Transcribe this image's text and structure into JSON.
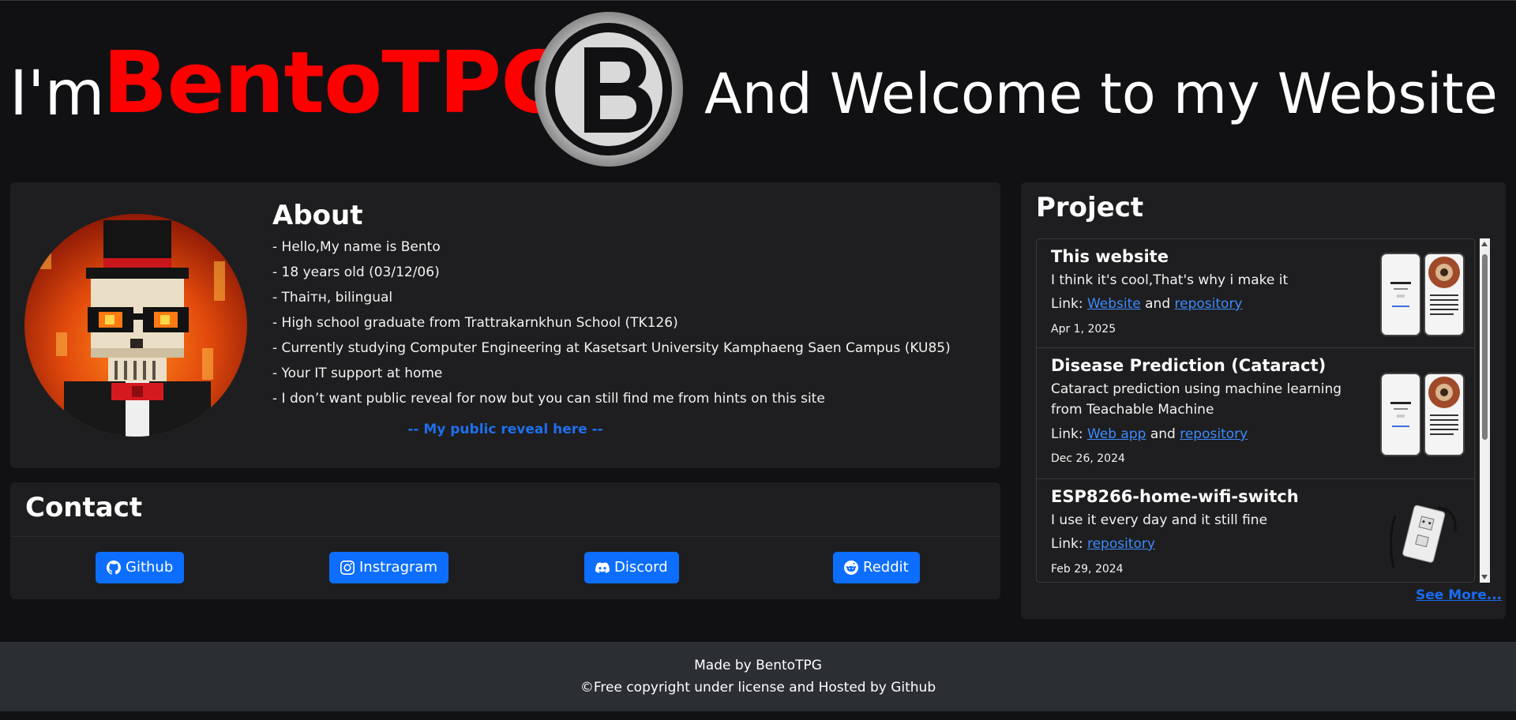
{
  "hero": {
    "prefix": "I'm",
    "name": "BentoTPG",
    "welcome": "And Welcome to my Website",
    "logo_icon": "bento-b-logo",
    "name_color": "#ff0000"
  },
  "about": {
    "title": "About",
    "avatar_icon": "skeleton-top-hat-avatar",
    "lines": [
      "- Hello,My name is Bento",
      "- 18 years old (03/12/06)",
      "- Thaiтн, bilingual",
      "- High school graduate from Trattrakarnkhun School (TK126)",
      "- Currently studying Computer Engineering at Kasetsart University Kamphaeng Saen Campus (KU85)",
      "- Your IT support at home",
      "- I don’t want public reveal for now but you can still find me from hints on this site"
    ],
    "reveal_link": "-- My public reveal here --"
  },
  "contact": {
    "title": "Contact",
    "buttons": [
      {
        "label": "Github",
        "icon": "github-icon"
      },
      {
        "label": "Instragram",
        "icon": "instagram-icon"
      },
      {
        "label": "Discord",
        "icon": "discord-icon"
      },
      {
        "label": "Reddit",
        "icon": "reddit-icon"
      }
    ],
    "button_color": "#0d6efd"
  },
  "projects": {
    "title": "Project",
    "items": [
      {
        "name": "This website",
        "description": "I think it's cool,That's why i make it",
        "link_prefix": "Link:",
        "links": [
          "Website",
          "repository"
        ],
        "link_joiner": "and",
        "date": "Apr 1, 2025",
        "thumb_icon": "phone-screenshots-thumbnail"
      },
      {
        "name": "Disease Prediction (Cataract)",
        "description": "Cataract prediction using machine learning from Teachable Machine",
        "link_prefix": "Link:",
        "links": [
          "Web app",
          "repository"
        ],
        "link_joiner": "and",
        "date": "Dec 26, 2024",
        "thumb_icon": "phone-screenshots-thumbnail"
      },
      {
        "name": "ESP8266-home-wifi-switch",
        "description": "I use it every day and it still fine",
        "link_prefix": "Link:",
        "links": [
          "repository"
        ],
        "date": "Feb 29, 2024",
        "thumb_icon": "wifi-switch-photo"
      }
    ],
    "see_more": "See More...",
    "link_color": "#3d8bfd"
  },
  "footer": {
    "line1": "Made by BentoTPG",
    "line2": "©Free copyright under license and Hosted by Github"
  }
}
